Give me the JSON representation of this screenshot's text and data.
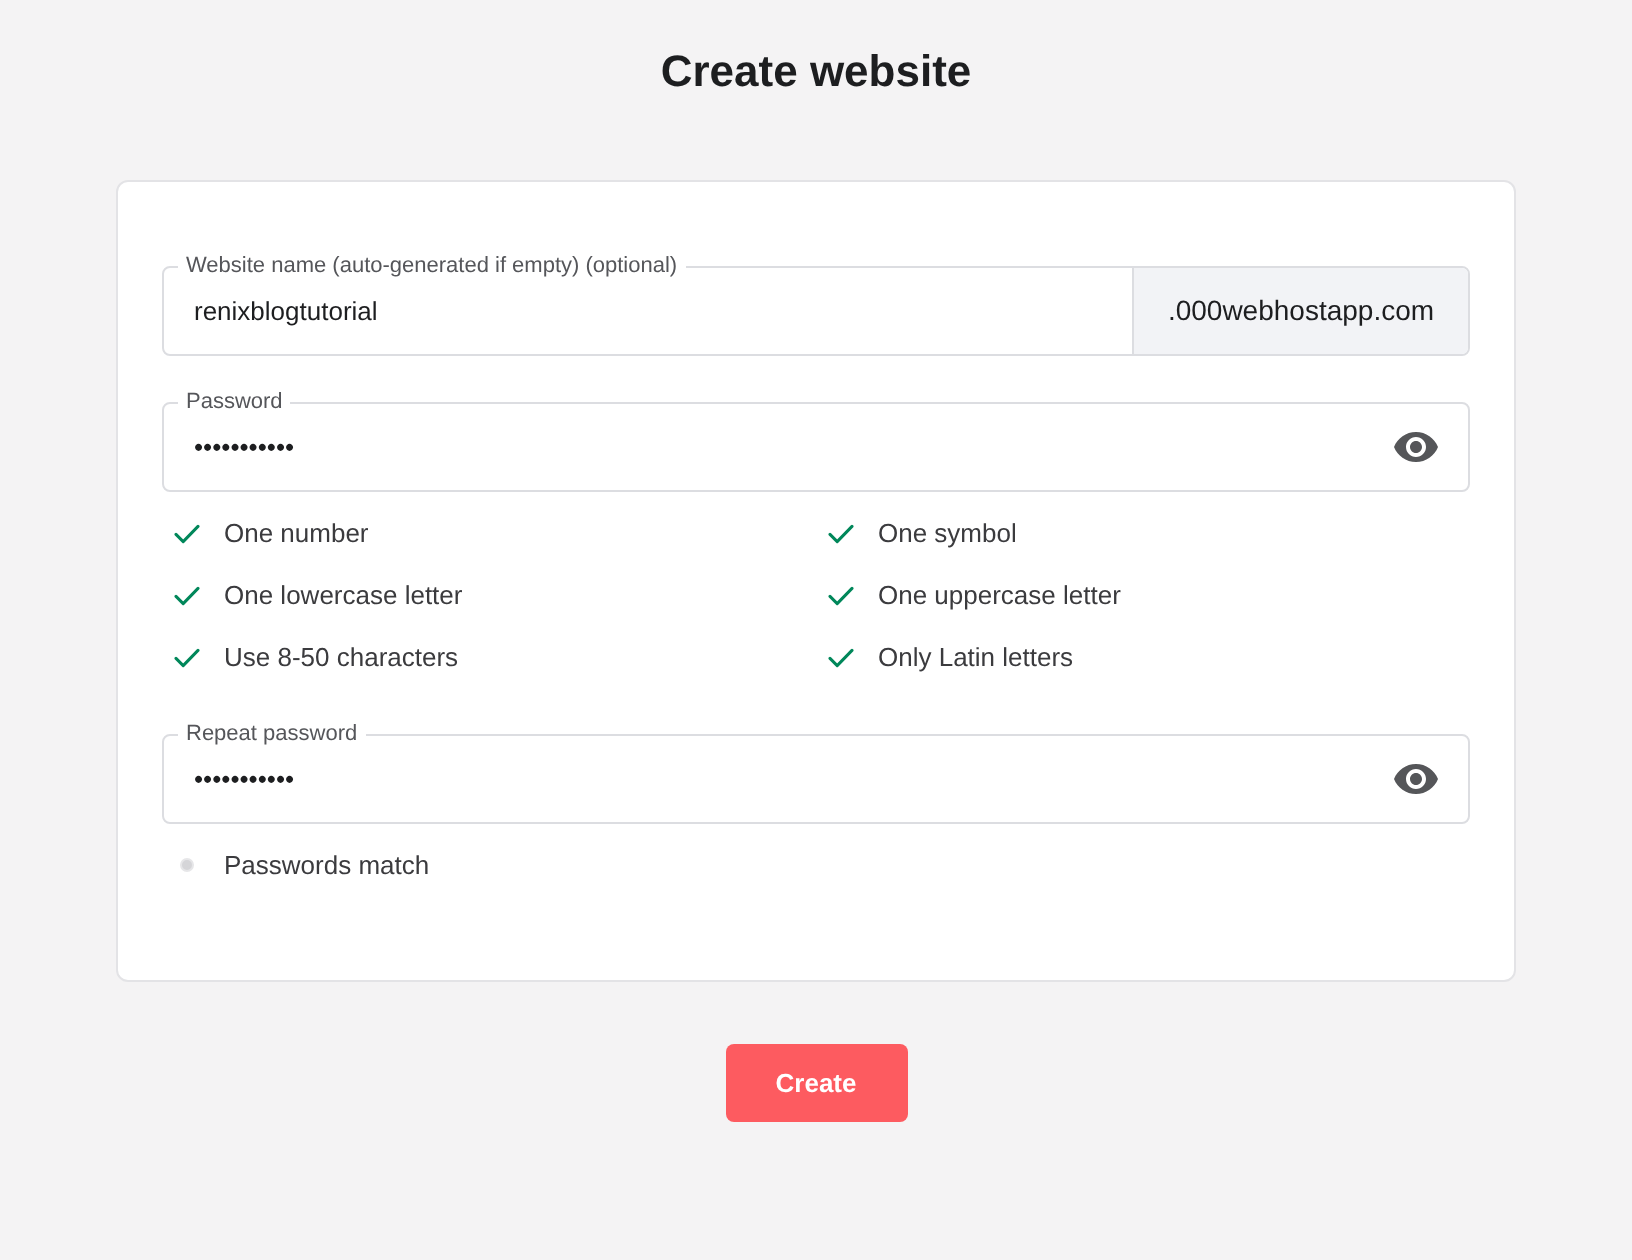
{
  "title": "Create website",
  "form": {
    "fields": [
      {
        "kind": "domain",
        "label": "Website name (auto-generated if empty) (optional)",
        "value": "renixblogtutorial",
        "suffix": ".000webhostapp.com"
      },
      {
        "kind": "password",
        "label": "Password",
        "value": "•••••••••••",
        "requirements": [
          {
            "text": "One number",
            "met": true
          },
          {
            "text": "One symbol",
            "met": true
          },
          {
            "text": "One lowercase letter",
            "met": true
          },
          {
            "text": "One uppercase letter",
            "met": true
          },
          {
            "text": "Use 8-50 characters",
            "met": true
          },
          {
            "text": "Only Latin letters",
            "met": true
          }
        ]
      },
      {
        "kind": "password",
        "label": "Repeat password",
        "value": "•••••••••••",
        "requirements": [
          {
            "text": "Passwords match",
            "met": false
          }
        ]
      }
    ]
  },
  "button": {
    "label": "Create"
  }
}
